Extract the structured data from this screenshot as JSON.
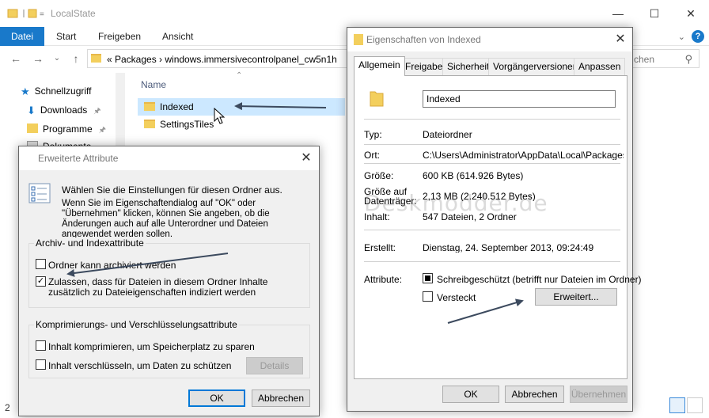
{
  "explorer": {
    "title": "LocalState",
    "ribbon_tabs": [
      {
        "label": "Datei",
        "active": true
      },
      {
        "label": "Start",
        "active": false
      },
      {
        "label": "Freigeben",
        "active": false
      },
      {
        "label": "Ansicht",
        "active": false
      }
    ],
    "address": "«  Packages  ›  windows.immersivecontrolpanel_cw5n1h",
    "search_placeholder": "chen",
    "nav_items": [
      "Schnellzugriff",
      "Downloads",
      "Programme",
      "Dokumente"
    ],
    "column_name": "Name",
    "files": [
      "Indexed",
      "SettingsTiles"
    ],
    "status_count": "2"
  },
  "props": {
    "title": "Eigenschaften von Indexed",
    "tabs": [
      "Allgemein",
      "Freigabe",
      "Sicherheit",
      "Vorgängerversionen",
      "Anpassen"
    ],
    "name": "Indexed",
    "type_label": "Typ:",
    "type_value": "Dateiordner",
    "location_label": "Ort:",
    "location_value": "C:\\Users\\Administrator\\AppData\\Local\\Packages\\w",
    "size_label": "Größe:",
    "size_value": "600 KB (614.926 Bytes)",
    "size_disk_label": "Größe auf Datenträger:",
    "size_disk_value": "2,13 MB (2.240.512 Bytes)",
    "contents_label": "Inhalt:",
    "contents_value": "547 Dateien, 2 Ordner",
    "created_label": "Erstellt:",
    "created_value": "Dienstag, 24. September 2013, 09:24:49",
    "attributes_label": "Attribute:",
    "readonly_label": "Schreibgeschützt (betrifft nur Dateien im Ordner)",
    "hidden_label": "Versteckt",
    "advanced_button": "Erweitert...",
    "ok": "OK",
    "cancel": "Abbrechen",
    "apply": "Übernehmen"
  },
  "adv": {
    "title": "Erweiterte Attribute",
    "intro": "Wählen Sie die Einstellungen für diesen Ordner aus.",
    "desc": "Wenn Sie im Eigenschaftendialog auf \"OK\" oder \"Übernehmen\" klicken, können Sie angeben, ob die Änderungen auch auf alle Unterordner und Dateien angewendet werden sollen.",
    "group1_title": "Archiv- und Indexattribute",
    "archive_label": "Ordner kann archiviert werden",
    "archive_checked": false,
    "index_label": "Zulassen, dass für Dateien in diesem Ordner Inhalte zusätzlich zu Dateieigenschaften indiziert werden",
    "index_checked": true,
    "group2_title": "Komprimierungs- und Verschlüsselungsattribute",
    "compress_label": "Inhalt komprimieren, um Speicherplatz zu sparen",
    "encrypt_label": "Inhalt verschlüsseln, um Daten zu schützen",
    "details_button": "Details",
    "ok": "OK",
    "cancel": "Abbrechen"
  },
  "watermark": "Deskmodder.de",
  "colors": {
    "accent": "#1979ca",
    "selection": "#cce8ff",
    "folder": "#f3cf5d",
    "arrow": "#3c4a5e"
  }
}
